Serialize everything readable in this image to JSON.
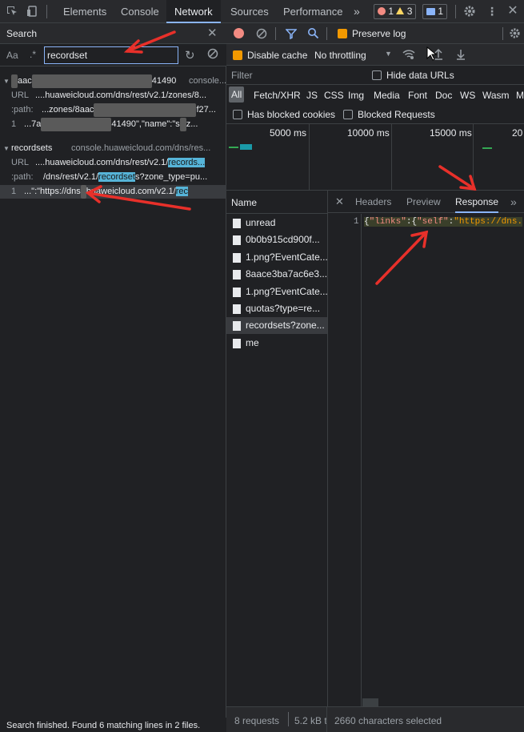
{
  "toolbar": {
    "tabs": [
      "Elements",
      "Console",
      "Network",
      "Sources",
      "Performance"
    ],
    "active_tab": "Network",
    "more": "»",
    "error_count": "1",
    "warning_count": "3",
    "message_count": "1"
  },
  "search": {
    "title": "Search",
    "case_label": "Aa",
    "regex_label": ".*",
    "query": "recordset",
    "status": "Search finished.  Found 6 matching lines in 2 files.",
    "groups": [
      {
        "file": "8aace3ba7ac6e3...41490",
        "file_visible_end": "41490",
        "origin": "console...",
        "rows": [
          {
            "key": "URL",
            "text": "....huaweicloud.com/dns/rest/v2.1/zones/8..."
          },
          {
            "key": ":path:",
            "text": "...zones/8aac",
            "tail": "f27..."
          },
          {
            "key": "1",
            "text": "...7a",
            "tail": "41490\",\"name\":\"s",
            "end": "z..."
          }
        ]
      },
      {
        "file": "recordsets",
        "origin": "console.huaweicloud.com/dns/res...",
        "rows": [
          {
            "key": "URL",
            "text": "....huaweicloud.com/dns/rest/v2.1/",
            "hl": "records..."
          },
          {
            "key": ":path:",
            "text": "/dns/rest/v2.1/",
            "hl": "recordset",
            "tail": "s?zone_type=pu..."
          },
          {
            "key": "1",
            "text": "...\":\"https://dns",
            "tail": "huaweicloud.com/v2.1/",
            "hl": "rec"
          }
        ]
      }
    ]
  },
  "network": {
    "preserve_log": "Preserve log",
    "disable_cache": "Disable cache",
    "throttling": "No throttling",
    "filter_placeholder": "Filter",
    "hide_data_urls": "Hide data URLs",
    "types": [
      "All",
      "Fetch/XHR",
      "JS",
      "CSS",
      "Img",
      "Media",
      "Font",
      "Doc",
      "WS",
      "Wasm",
      "M"
    ],
    "has_blocked_cookies": "Has blocked cookies",
    "blocked_requests": "Blocked Requests",
    "timeline_labels": [
      "5000 ms",
      "10000 ms",
      "15000 ms",
      "20"
    ],
    "name_header": "Name",
    "requests": [
      "unread",
      "0b0b915cd900f...",
      "1.png?EventCate...",
      "8aace3ba7ac6e3...",
      "1.png?EventCate...",
      "quotas?type=re...",
      "recordsets?zone...",
      "me"
    ],
    "selected_request": "recordsets?zone...",
    "detail_tabs": [
      "Headers",
      "Preview",
      "Response"
    ],
    "active_detail_tab": "Response",
    "line_number": "1",
    "response_text": {
      "brace1": "{",
      "key1": "\"links\"",
      "colon1": ":",
      "brace2": "{",
      "key2": "\"self\"",
      "colon2": ":",
      "value": "\"https://dns."
    },
    "requests_count": "8 requests",
    "transferred": "5.2 kB t",
    "characters_selected": "2660 characters selected"
  },
  "colors": {
    "annotation_arrow": "#e8302a",
    "highlight": "#56b4d8",
    "accent": "#8ab4f8"
  }
}
